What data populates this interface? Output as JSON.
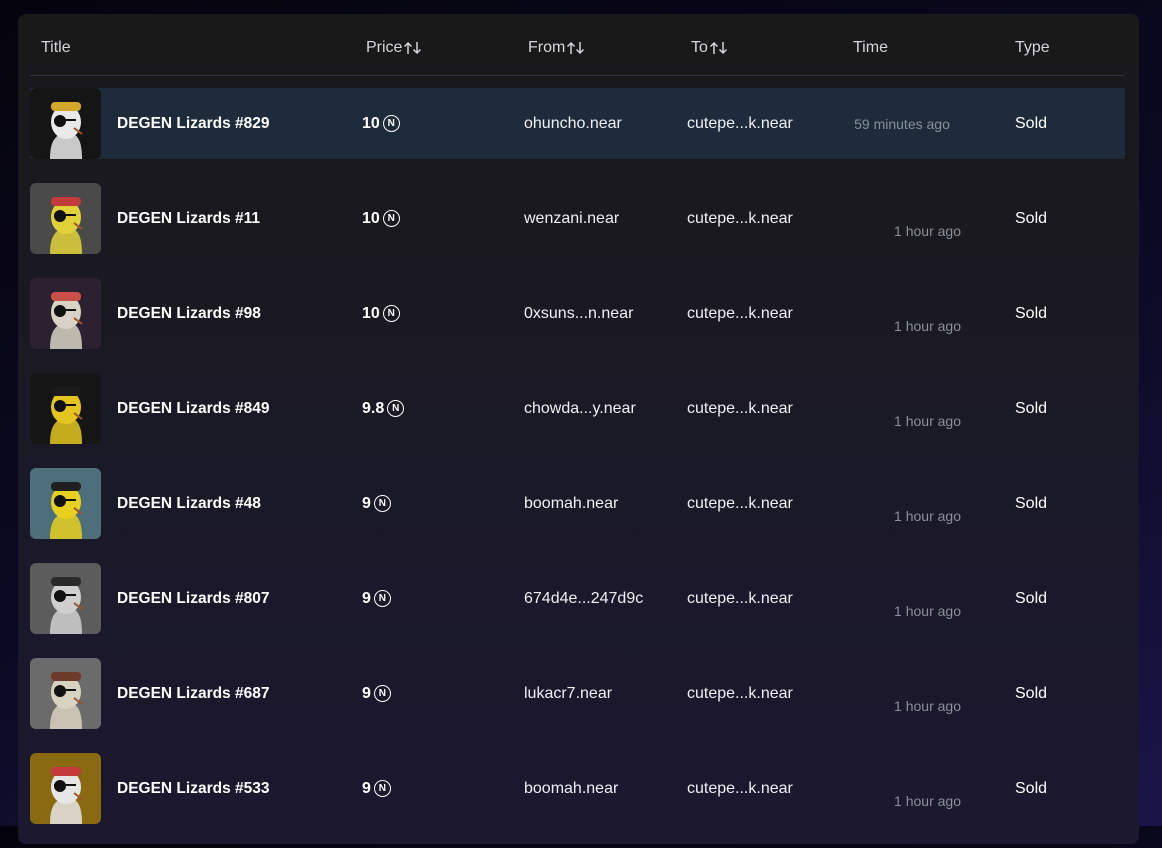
{
  "table": {
    "headers": {
      "title": "Title",
      "price": "Price",
      "from": "From",
      "to": "To",
      "time": "Time",
      "type": "Type"
    },
    "currency_icon": "near-icon",
    "currency_glyph": "N",
    "rows": [
      {
        "title": "DEGEN Lizards #829",
        "price": "10",
        "from": "ohuncho.near",
        "to": "cutepe...k.near",
        "time": "59 minutes ago",
        "type": "Sold",
        "thumb_bg": "#151515",
        "skin": "#e9e9e9",
        "hat": "#d4a82b"
      },
      {
        "title": "DEGEN Lizards #11",
        "price": "10",
        "from": "wenzani.near",
        "to": "cutepe...k.near",
        "time": "1 hour ago",
        "type": "Sold",
        "thumb_bg": "#4a4a4a",
        "skin": "#e2d23a",
        "hat": "#c43b3b"
      },
      {
        "title": "DEGEN Lizards #98",
        "price": "10",
        "from": "0xsuns...n.near",
        "to": "cutepe...k.near",
        "time": "1 hour ago",
        "type": "Sold",
        "thumb_bg": "#2b2130",
        "skin": "#d8d3c4",
        "hat": "#c9504a"
      },
      {
        "title": "DEGEN Lizards #849",
        "price": "9.8",
        "from": "chowda...y.near",
        "to": "cutepe...k.near",
        "time": "1 hour ago",
        "type": "Sold",
        "thumb_bg": "#151515",
        "skin": "#e4c520",
        "hat": "#1a1a1a"
      },
      {
        "title": "DEGEN Lizards #48",
        "price": "9",
        "from": "boomah.near",
        "to": "cutepe...k.near",
        "time": "1 hour ago",
        "type": "Sold",
        "thumb_bg": "#4c6f7b",
        "skin": "#e8d020",
        "hat": "#1f1f1f"
      },
      {
        "title": "DEGEN Lizards #807",
        "price": "9",
        "from": "674d4e...247d9c",
        "to": "cutepe...k.near",
        "time": "1 hour ago",
        "type": "Sold",
        "thumb_bg": "#5c5c5c",
        "skin": "#cfcfcf",
        "hat": "#2a2a2a"
      },
      {
        "title": "DEGEN Lizards #687",
        "price": "9",
        "from": "lukacr7.near",
        "to": "cutepe...k.near",
        "time": "1 hour ago",
        "type": "Sold",
        "thumb_bg": "#6b6b6b",
        "skin": "#d8d2c0",
        "hat": "#6b3a2a"
      },
      {
        "title": "DEGEN Lizards #533",
        "price": "9",
        "from": "boomah.near",
        "to": "cutepe...k.near",
        "time": "1 hour ago",
        "type": "Sold",
        "thumb_bg": "#8a6a10",
        "skin": "#e6e6e6",
        "hat": "#c43b3b"
      }
    ],
    "highlighted_row": 0
  },
  "colors": {
    "row_highlight": "#1e2b3b",
    "muted_text": "#8a8f99"
  }
}
